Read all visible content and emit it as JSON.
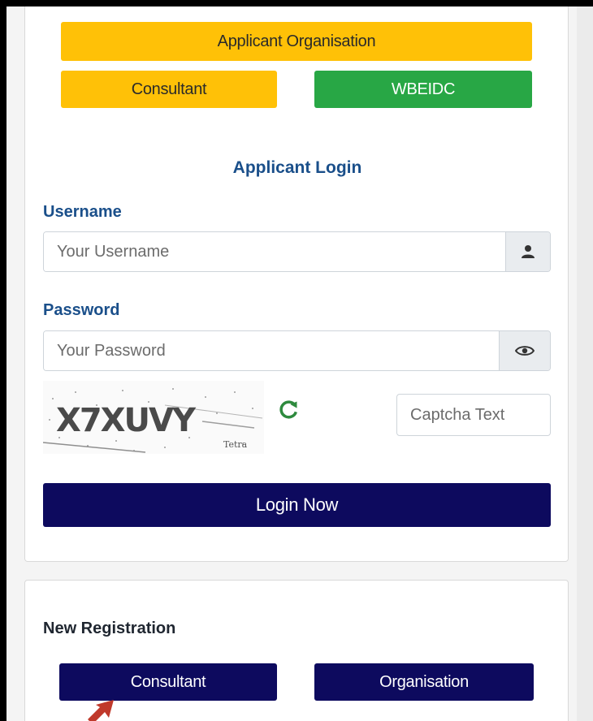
{
  "portals": {
    "applicant_organisation": "Applicant Organisation",
    "consultant": "Consultant",
    "wbeidc": "WBEIDC"
  },
  "login": {
    "heading": "Applicant Login",
    "username_label": "Username",
    "username_placeholder": "Your Username",
    "password_label": "Password",
    "password_placeholder": "Your Password",
    "captcha_code": "X7XUVY",
    "captcha_sub": "Tetra",
    "captcha_placeholder": "Captcha Text",
    "submit_label": "Login Now"
  },
  "registration": {
    "title": "New Registration",
    "consultant_label": "Consultant",
    "organisation_label": "Organisation"
  },
  "colors": {
    "yellow": "#ffc107",
    "green": "#28a745",
    "navy": "#0d0a5e",
    "heading_blue": "#1a4f8a"
  },
  "icons": {
    "username": "user-icon",
    "password": "eye-icon",
    "captcha_refresh": "refresh-icon",
    "annotation": "red-arrow-icon"
  }
}
